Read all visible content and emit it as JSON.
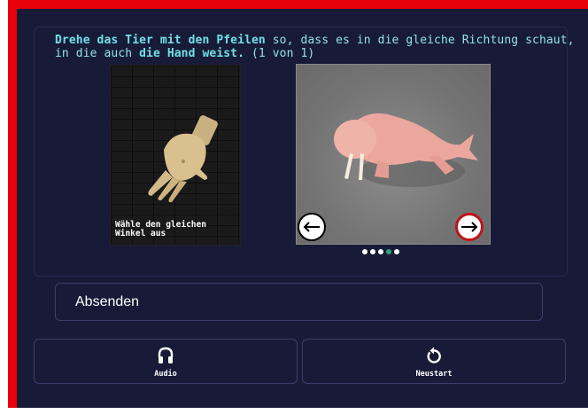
{
  "instruction": {
    "part1": "Drehe das Tier mit den Pfeilen",
    "part2": " so, dass es in die gleiche Richtung schaut, in die auch ",
    "part3": "die Hand weist.",
    "part4": " (1 von 1)"
  },
  "reference": {
    "caption": "Wähle den gleichen Winkel aus"
  },
  "carousel": {
    "dot_count": 5,
    "active_index": 3,
    "left_icon": "arrow-left-icon",
    "right_icon": "arrow-right-icon"
  },
  "actions": {
    "submit_label": "Absenden",
    "audio_label": "Audio",
    "restart_label": "Neustart"
  },
  "colors": {
    "background": "#181b37",
    "frame": "#e8000b",
    "instruction_text": "#8fe3e8",
    "active_dot": "#2ea37a"
  }
}
